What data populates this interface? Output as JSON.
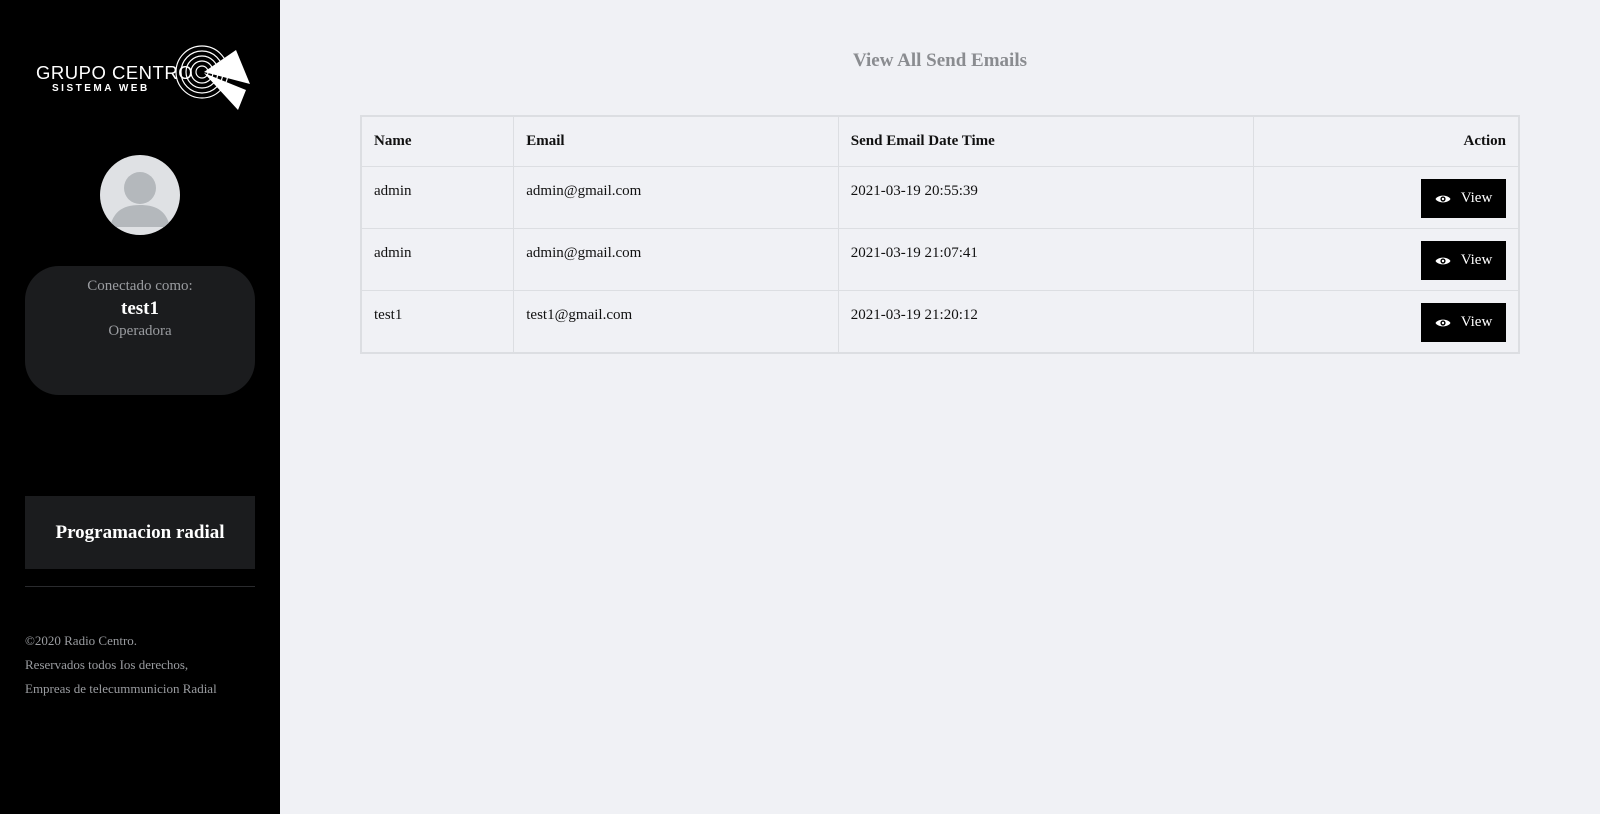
{
  "brand": {
    "logo_main": "GRUPO CENTRO",
    "logo_sub": "SISTEMA WEB"
  },
  "profile": {
    "connected_label": "Conectado como:",
    "username": "test1",
    "role": "Operadora"
  },
  "nav": {
    "items": [
      {
        "label": "Programacion radial"
      }
    ]
  },
  "footer": {
    "line1": "©2020 Radio Centro.",
    "line2": "Reservados todos Ios derechos,",
    "line3": "Empreas de telecummunicion Radial"
  },
  "page": {
    "title": "View All Send Emails"
  },
  "table": {
    "headers": {
      "name": "Name",
      "email": "Email",
      "datetime": "Send Email Date Time",
      "action": "Action"
    },
    "rows": [
      {
        "name": "admin",
        "email": "admin@gmail.com",
        "datetime": "2021-03-19 20:55:39",
        "action_label": "View"
      },
      {
        "name": "admin",
        "email": "admin@gmail.com",
        "datetime": "2021-03-19 21:07:41",
        "action_label": "View"
      },
      {
        "name": "test1",
        "email": "test1@gmail.com",
        "datetime": "2021-03-19 21:20:12",
        "action_label": "View"
      }
    ]
  },
  "icons": {
    "logo_mark": "radio-signal-icon",
    "avatar": "user-silhouette-icon",
    "view": "eye-icon"
  },
  "colors": {
    "sidebar_bg": "#000000",
    "card_bg": "#1b1c1e",
    "content_bg": "#f0f1f5",
    "button_bg": "#000000",
    "muted_text": "#9a9ca0"
  }
}
